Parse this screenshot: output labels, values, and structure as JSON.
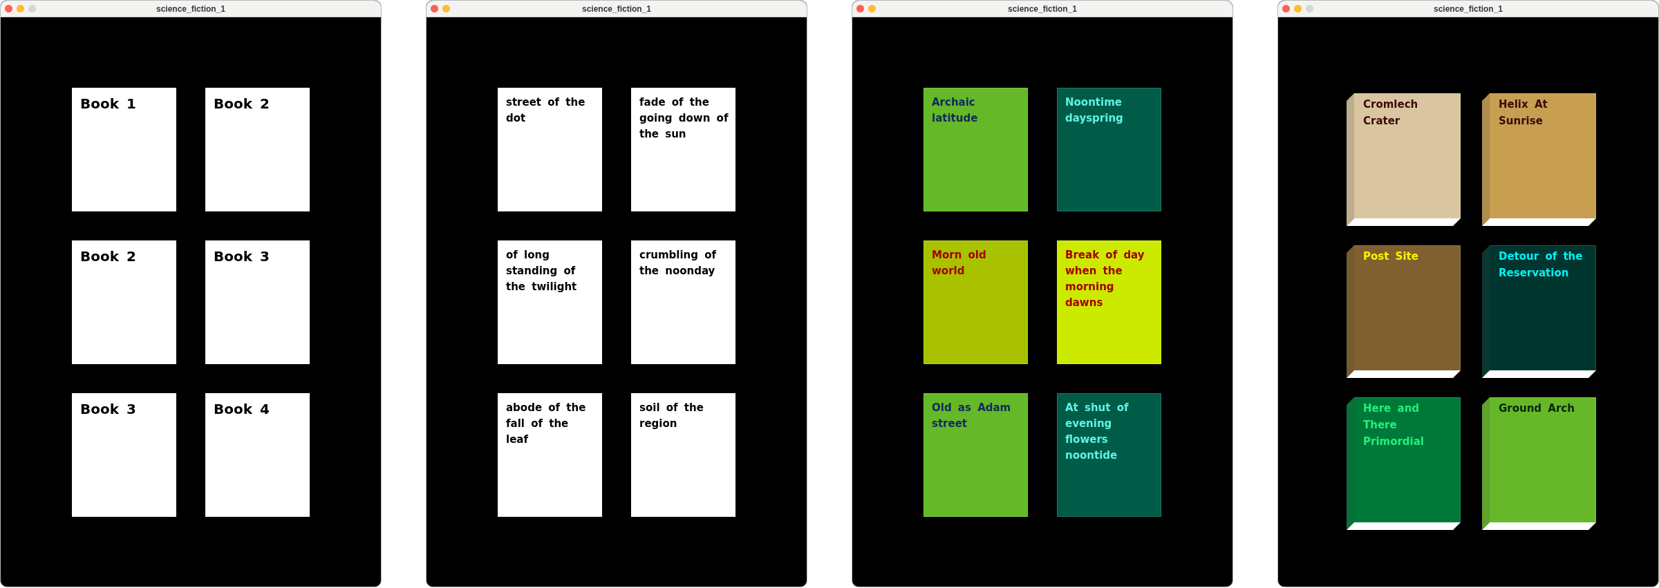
{
  "windows": [
    {
      "title": "science_fiction_1",
      "zoom_button": true,
      "kind": "heading",
      "books": [
        {
          "title": "Book 1"
        },
        {
          "title": "Book 2"
        },
        {
          "title": "Book 2"
        },
        {
          "title": "Book 3"
        },
        {
          "title": "Book 3"
        },
        {
          "title": "Book 4"
        }
      ]
    },
    {
      "title": "science_fiction_1",
      "zoom_button": false,
      "kind": "plain",
      "books": [
        {
          "title": "street of the dot"
        },
        {
          "title": "fade of the going down of the sun"
        },
        {
          "title": "of long standing of the twilight"
        },
        {
          "title": "crumbling of the noonday"
        },
        {
          "title": "abode of the fall of the leaf"
        },
        {
          "title": "soil of the region"
        }
      ]
    },
    {
      "title": "science_fiction_1",
      "zoom_button": false,
      "kind": "colored",
      "books": [
        {
          "title": "Archaic latitude",
          "color": "#65b827",
          "lettering": {
            "color": "#0f2a5c"
          }
        },
        {
          "title": "Noontime dayspring",
          "color": "#005c46",
          "lettering": {
            "color": "#5ff2e4"
          }
        },
        {
          "title": "Morn old world",
          "color": "#a8c200",
          "lettering": {
            "color": "#a30000"
          }
        },
        {
          "title": "Break of day when the morning dawns",
          "color": "#ccea00",
          "lettering": {
            "color": "#a30000"
          }
        },
        {
          "title": "Old as Adam street",
          "color": "#65b827",
          "lettering": {
            "color": "#0f2a5c"
          }
        },
        {
          "title": "At shut of evening flowers noontide",
          "color": "#005c46",
          "lettering": {
            "color": "#5ff2e4"
          }
        }
      ]
    },
    {
      "title": "science_fiction_1",
      "zoom_button": true,
      "kind": "volume",
      "books": [
        {
          "title": "Cromlech Crater",
          "color": "#d9c6a0",
          "lettering": {
            "color": "#3b0a0a"
          }
        },
        {
          "title": "Helix At Sunrise",
          "color": "#c89e50",
          "lettering": {
            "color": "#3b0a0a"
          }
        },
        {
          "title": "Post Site",
          "color": "#80602e",
          "lettering": {
            "color": "#fff200"
          }
        },
        {
          "title": "Detour of the Reservation",
          "color": "#003530",
          "lettering": {
            "color": "#00f2f2"
          }
        },
        {
          "title": "Here and There Primordial",
          "color": "#007838",
          "lettering": {
            "color": "#22f07c"
          }
        },
        {
          "title": "Ground Arch",
          "color": "#66b828",
          "lettering": {
            "color": "#0b240b"
          }
        }
      ]
    }
  ]
}
